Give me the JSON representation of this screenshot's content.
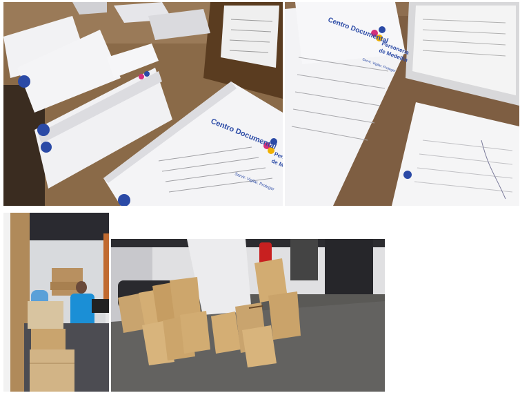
{
  "photos": [
    {
      "caption": "",
      "folder_labels": {
        "heading": "Centro Documental",
        "brand_line1": "Personería",
        "brand_line2": "de Medellín",
        "tagline": "Servir. Vigilar. Proteger"
      }
    },
    {
      "caption": "",
      "folder_labels": {
        "heading": "Centro Documental",
        "brand_line1": "Personería",
        "brand_line2": "de Medellín",
        "tagline": "Servir. Vigilar. Proteger"
      }
    },
    {
      "caption": ""
    },
    {
      "caption": ""
    }
  ],
  "colors": {
    "desk_wood": "#8a6a48",
    "folder_white": "#f2f2f4",
    "label_blue": "#2b4aa6",
    "logo_pink": "#d4307a",
    "box_cardboard": "#c9a46e",
    "office_wall": "#e7e7e9",
    "floor_gray": "#5a5956",
    "vest_blue": "#1b8fd6"
  }
}
